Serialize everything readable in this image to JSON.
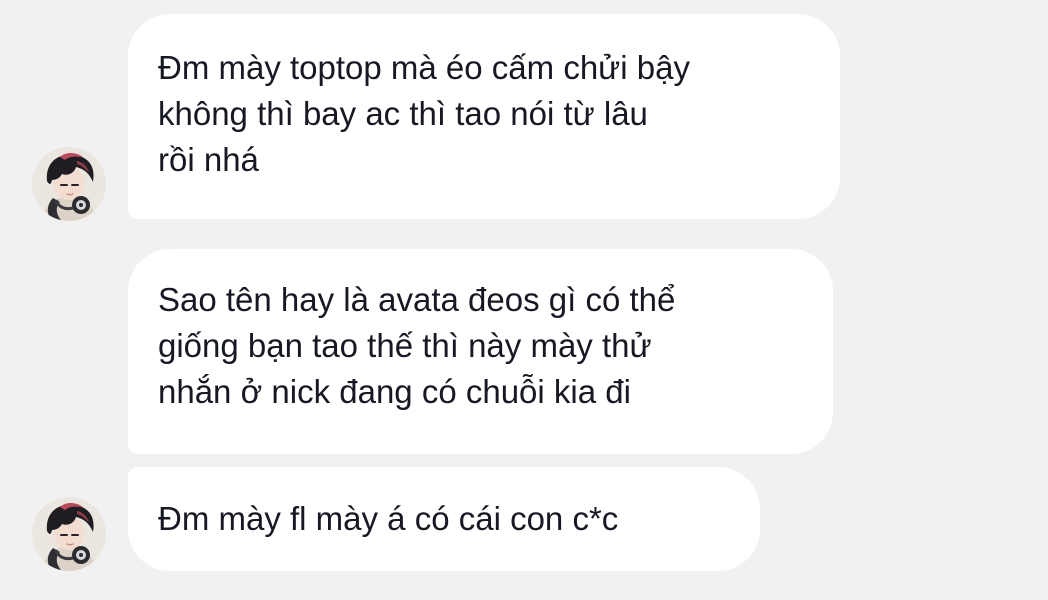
{
  "messages": [
    {
      "sender": "other",
      "text": "Đm mày toptop mà éo cấm chửi bậy\nkhông thì bay ac thì tao nói từ lâu\nrồi nhá"
    },
    {
      "sender": "other",
      "text": "Sao tên hay là avata đeos gì có thể\ngiống bạn tao thế thì này mày thử\nnhắn ở nick đang có chuỗi kia đi"
    },
    {
      "sender": "other",
      "text": "Đm mày fl mày á có cái con c*c"
    }
  ],
  "avatar_icon": "anime-boy-headphones-avatar",
  "colors": {
    "background": "#f1f1f2",
    "bubble": "#ffffff",
    "text": "#161823"
  }
}
